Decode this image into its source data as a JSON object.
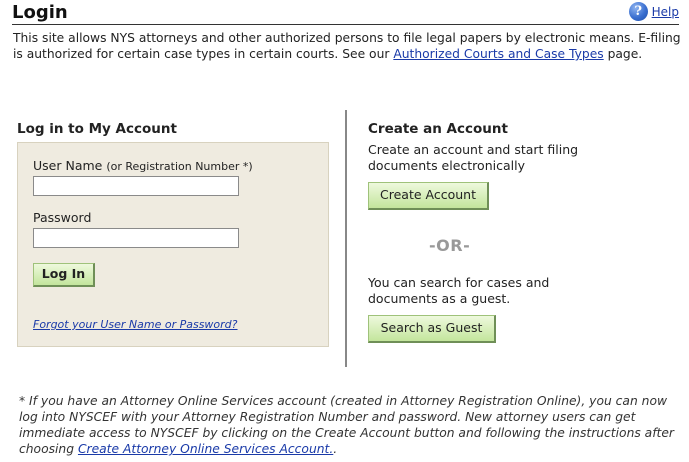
{
  "header": {
    "title": "Login",
    "help_label": "Help",
    "help_icon": "?"
  },
  "intro": {
    "text_before": "This site allows NYS attorneys and other authorized persons to file legal papers by electronic means. E-filing is authorized for certain case types in certain courts. See our ",
    "link": "Authorized Courts and Case Types",
    "text_after": " page."
  },
  "login": {
    "heading": "Log in to My Account",
    "username_label": "User Name",
    "username_hint": "(or Registration Number *)",
    "username_value": "",
    "password_label": "Password",
    "password_value": "",
    "login_button": "Log In",
    "forgot_link": "Forgot your User Name or Password?"
  },
  "create": {
    "heading": "Create an Account",
    "description": "Create an account and start filing documents electronically",
    "create_button": "Create Account",
    "or_text": "-OR-",
    "guest_description": "You can search for cases and documents as a guest.",
    "guest_button": "Search as Guest"
  },
  "footnote": {
    "text_before": "* If you have an Attorney Online Services account (created in Attorney Registration Online), you can now log into NYSCEF with your Attorney Registration Number and password. New attorney users can get immediate access to NYSCEF by clicking on the Create Account button and following the instructions after choosing ",
    "link": "Create Attorney Online Services Account.",
    "text_after": "."
  }
}
